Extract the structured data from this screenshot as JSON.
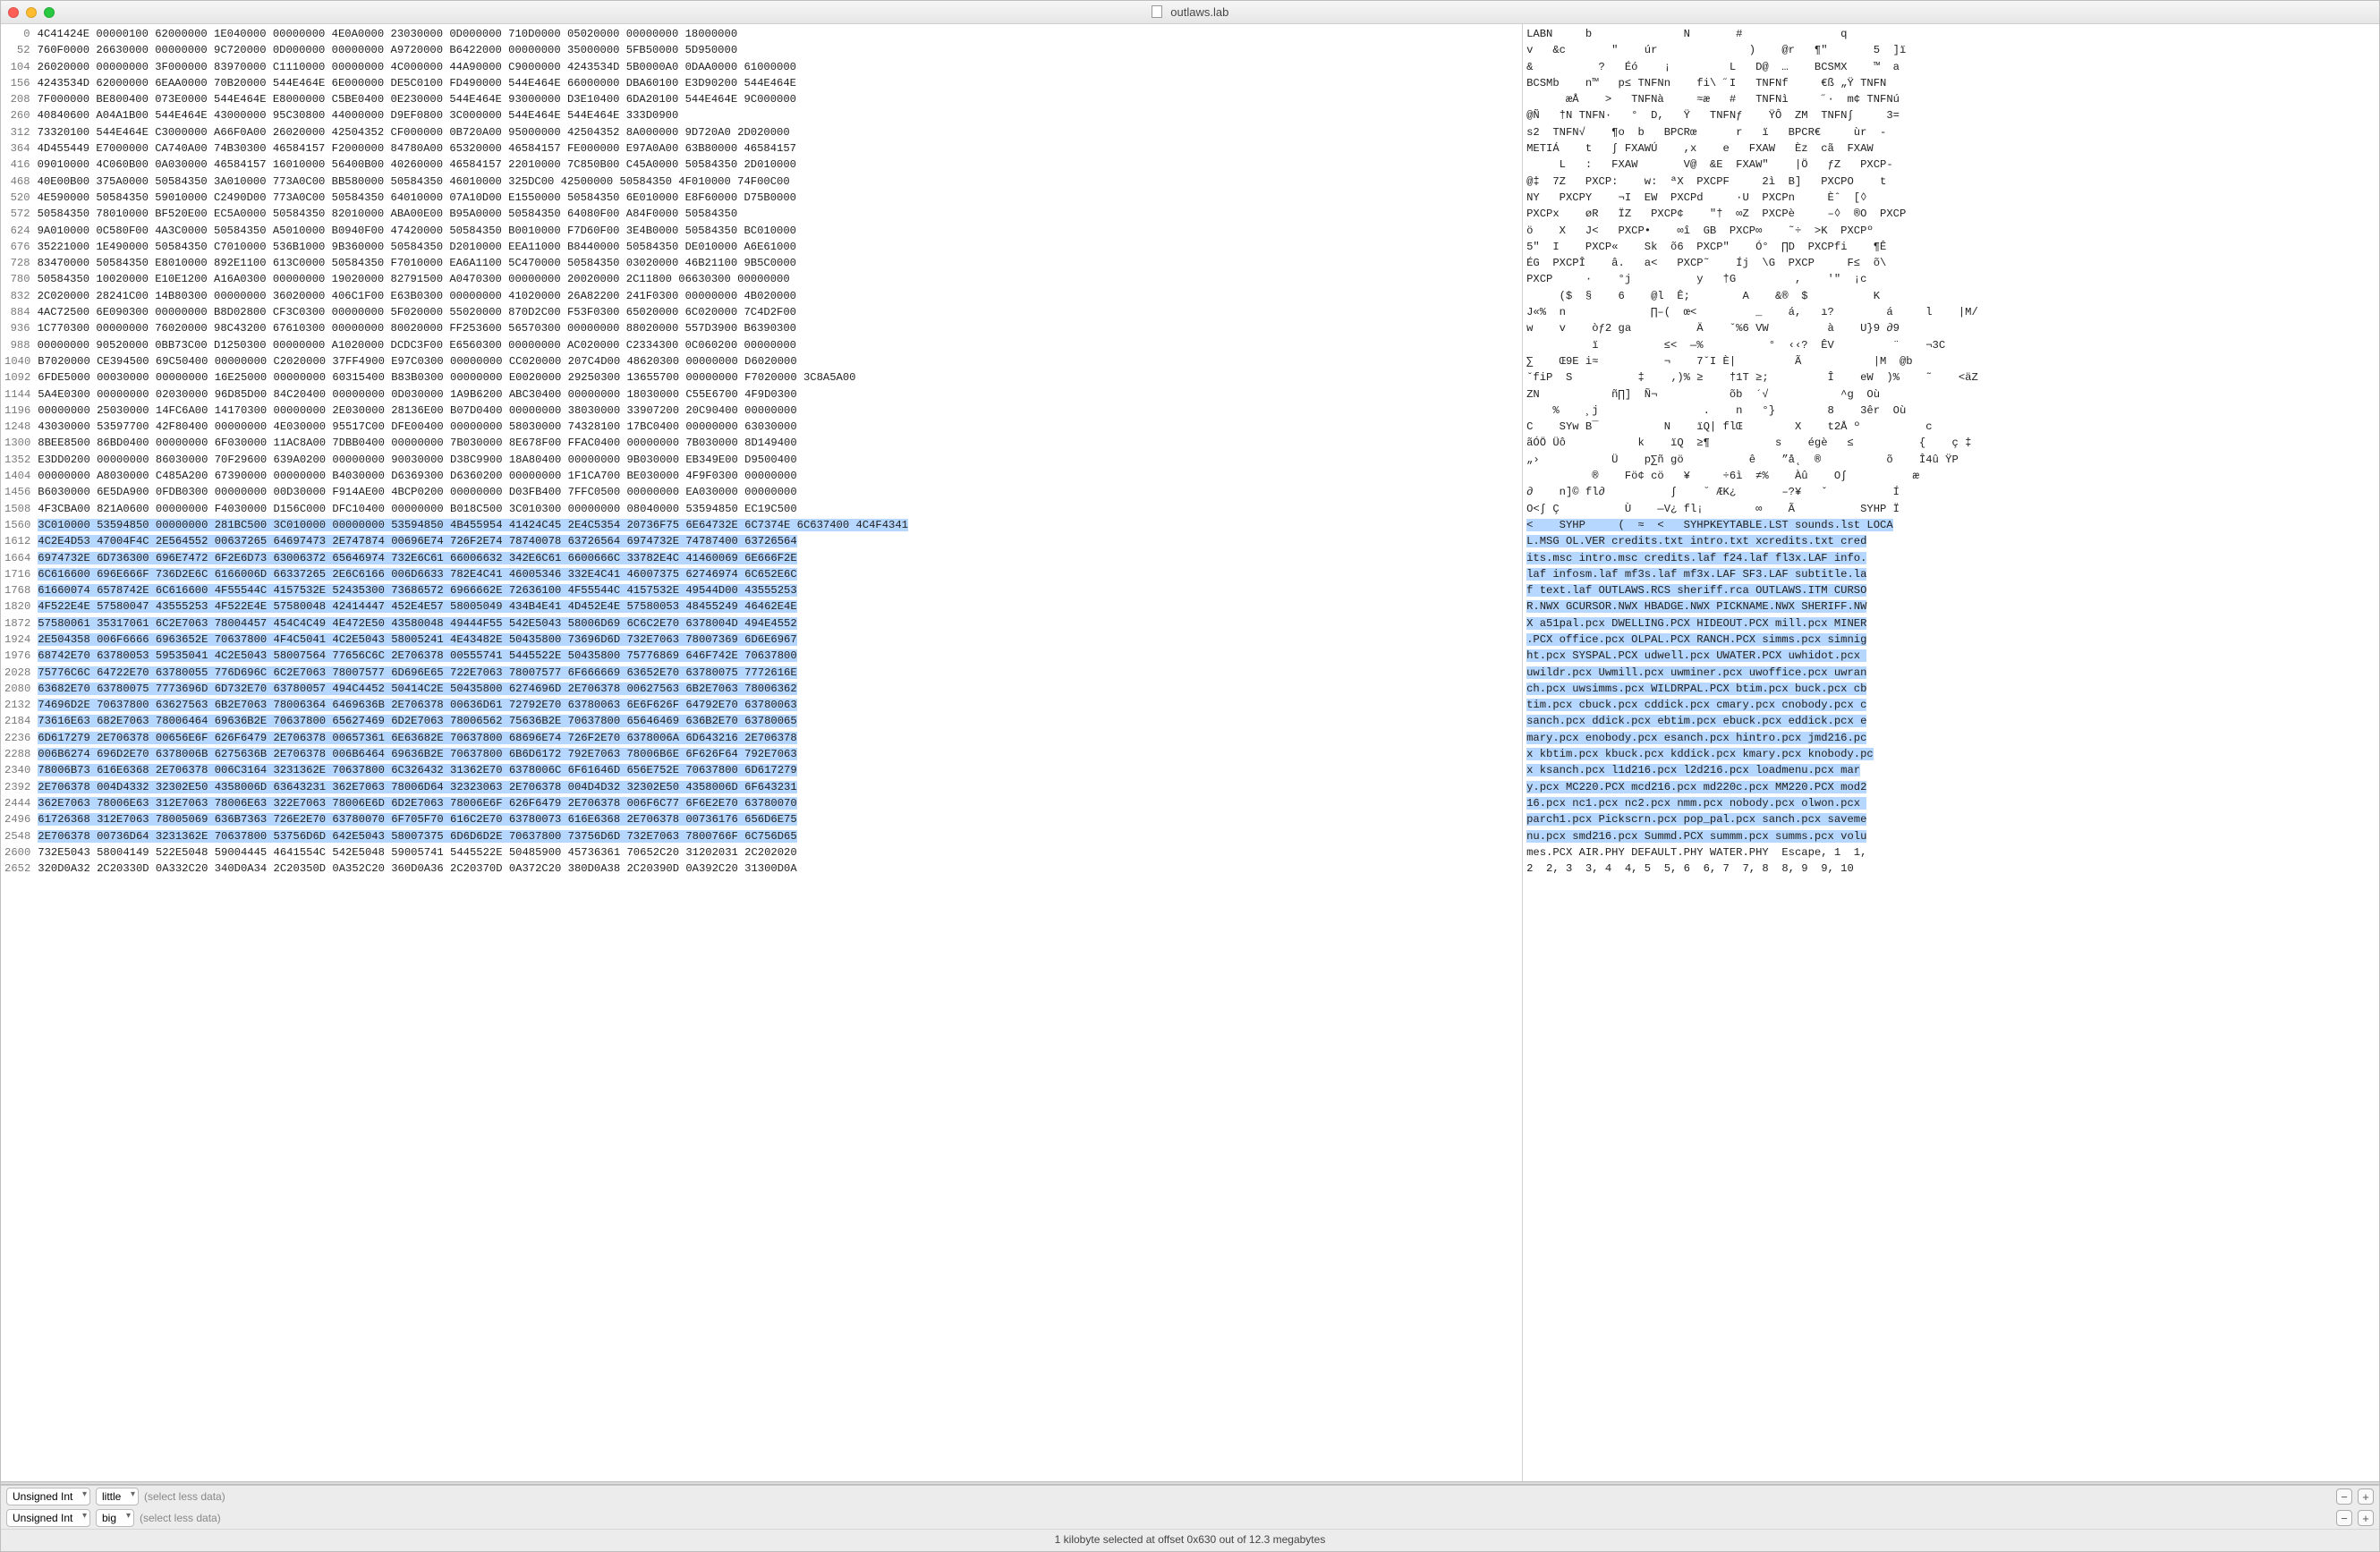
{
  "window": {
    "title": "outlaws.lab"
  },
  "hex": {
    "start_offset": 0,
    "bytes_per_row": 52,
    "selection": {
      "start": 1560,
      "end": 2599
    },
    "rows": [
      {
        "o": 0,
        "h": "4C41424E 00000100 62000000 1E040000 00000000 4E0A0000 23030000 0D000000 710D0000 05020000 00000000 18000000"
      },
      {
        "o": 52,
        "h": "760F0000 26630000 00000000 9C720000 0D000000 00000000 A9720000 B6422000 00000000 35000000 5FB50000 5D950000"
      },
      {
        "o": 104,
        "h": "26020000 00000000 3F000000 83970000 C1110000 00000000 4C000000 44A90000 C9000000 4243534D 5B0000A0 0DAA0000 61000000"
      },
      {
        "o": 156,
        "h": "4243534D 62000000 6EAA0000 70B20000 544E464E 6E000000 DE5C0100 FD490000 544E464E 66000000 DBA60100 E3D90200 544E464E"
      },
      {
        "o": 208,
        "h": "7F000000 BE800400 073E0000 544E464E E8000000 C5BE0400 0E230000 544E464E 93000000 D3E10400 6DA20100 544E464E 9C000000"
      },
      {
        "o": 260,
        "h": "40840600 A04A1B00 544E464E 43000000 95C30800 44000000 D9EF0800 3C000000 544E464E 544E464E 333D0900"
      },
      {
        "o": 312,
        "h": "73320100 544E464E C3000000 A66F0A00 26020000 42504352 CF000000 0B720A00 95000000 42504352 8A000000 9D720A0 2D020000"
      },
      {
        "o": 364,
        "h": "4D455449 E7000000 CA740A00 74B30300 46584157 F2000000 84780A00 65320000 46584157 FE000000 E97A0A00 63B80000 46584157"
      },
      {
        "o": 416,
        "h": "09010000 4C060B00 0A030000 46584157 16010000 56400B00 40260000 46584157 22010000 7C850B00 C45A0000 50584350 2D010000"
      },
      {
        "o": 468,
        "h": "40E00B00 375A0000 50584350 3A010000 773A0C00 BB580000 50584350 46010000 325DC00 42500000 50584350 4F010000 74F00C00"
      },
      {
        "o": 520,
        "h": "4E590000 50584350 59010000 C2490D00 773A0C00 50584350 64010000 07A10D00 E1550000 50584350 6E010000 E8F60000 D75B0000"
      },
      {
        "o": 572,
        "h": "50584350 78010000 BF520E00 EC5A0000 50584350 82010000 ABA00E00 B95A0000 50584350 64080F00 A84F0000 50584350"
      },
      {
        "o": 624,
        "h": "9A010000 0C580F00 4A3C0000 50584350 A5010000 B0940F00 47420000 50584350 B0010000 F7D60F00 3E4B0000 50584350 BC010000"
      },
      {
        "o": 676,
        "h": "35221000 1E490000 50584350 C7010000 536B1000 9B360000 50584350 D2010000 EEA11000 B8440000 50584350 DE010000 A6E61000"
      },
      {
        "o": 728,
        "h": "83470000 50584350 E8010000 892E1100 613C0000 50584350 F7010000 EA6A1100 5C470000 50584350 03020000 46B21100 9B5C0000"
      },
      {
        "o": 780,
        "h": "50584350 10020000 E10E1200 A16A0300 00000000 19020000 82791500 A0470300 00000000 20020000 2C11800 06630300 00000000"
      },
      {
        "o": 832,
        "h": "2C020000 28241C00 14B80300 00000000 36020000 406C1F00 E63B0300 00000000 41020000 26A82200 241F0300 00000000 4B020000"
      },
      {
        "o": 884,
        "h": "4AC72500 6E090300 00000000 B8D02800 CF3C0300 00000000 5F020000 55020000 870D2C00 F53F0300 65020000 6C020000 7C4D2F00"
      },
      {
        "o": 936,
        "h": "1C770300 00000000 76020000 98C43200 67610300 00000000 80020000 FF253600 56570300 00000000 88020000 557D3900 B6390300"
      },
      {
        "o": 988,
        "h": "00000000 90520000 0BB73C00 D1250300 00000000 A1020000 DCDC3F00 E6560300 00000000 AC020000 C2334300 0C060200 00000000"
      },
      {
        "o": 1040,
        "h": "B7020000 CE394500 69C50400 00000000 C2020000 37FF4900 E97C0300 00000000 CC020000 207C4D00 48620300 00000000 D6020000"
      },
      {
        "o": 1092,
        "h": "6FDE5000 00030000 00000000 16E25000 00000000 60315400 B83B0300 00000000 E0020000 29250300 13655700 00000000 F7020000 3C8A5A00"
      },
      {
        "o": 1144,
        "h": "5A4E0300 00000000 02030000 96D85D00 84C20400 00000000 0D030000 1A9B6200 ABC30400 00000000 18030000 C55E6700 4F9D0300"
      },
      {
        "o": 1196,
        "h": "00000000 25030000 14FC6A00 14170300 00000000 2E030000 28136E00 B07D0400 00000000 38030000 33907200 20C90400 00000000"
      },
      {
        "o": 1248,
        "h": "43030000 53597700 42F80400 00000000 4E030000 95517C00 DFE00400 00000000 58030000 74328100 17BC0400 00000000 63030000"
      },
      {
        "o": 1300,
        "h": "8BEE8500 86BD0400 00000000 6F030000 11AC8A00 7DBB0400 00000000 7B030000 8E678F00 FFAC0400 00000000 7B030000 8D149400"
      },
      {
        "o": 1352,
        "h": "E3DD0200 00000000 86030000 70F29600 639A0200 00000000 90030000 D38C9900 18A80400 00000000 9B030000 EB349E00 D9500400"
      },
      {
        "o": 1404,
        "h": "00000000 A8030000 C485A200 67390000 00000000 B4030000 D6369300 D6360200 00000000 1F1CA700 BE030000 4F9F0300 00000000"
      },
      {
        "o": 1456,
        "h": "B6030000 6E5DA900 0FDB0300 00000000 00D30000 F914AE00 4BCP0200 00000000 D03FB400 7FFC0500 00000000 EA030000 00000000"
      },
      {
        "o": 1508,
        "h": "4F3CBA00 821A0600 00000000 F4030000 D156C000 DFC10400 00000000 B018C500 3C010300 00000000 08040000 53594850 EC19C500"
      },
      {
        "o": 1560,
        "h": "3C010000 53594850 00000000 281BC500 3C010000 00000000 53594850 4B455954 41424C45 2E4C5354 20736F75 6E64732E 6C7374E 6C637400 4C4F4341"
      },
      {
        "o": 1612,
        "h": "4C2E4D53 47004F4C 2E564552 00637265 64697473 2E747874 00696E74 726F2E74 78740078 63726564 6974732E 74787400 63726564"
      },
      {
        "o": 1664,
        "h": "6974732E 6D736300 696E7472 6F2E6D73 63006372 65646974 732E6C61 66006632 342E6C61 6600666C 33782E4C 41460069 6E666F2E"
      },
      {
        "o": 1716,
        "h": "6C616600 696E666F 736D2E6C 6166006D 66337265 2E6C6166 006D6633 782E4C41 46005346 332E4C41 46007375 62746974 6C652E6C"
      },
      {
        "o": 1768,
        "h": "61660074 6578742E 6C616600 4F55544C 4157532E 52435300 73686572 6966662E 72636100 4F55544C 4157532E 49544D00 43555253"
      },
      {
        "o": 1820,
        "h": "4F522E4E 57580047 43555253 4F522E4E 57580048 42414447 452E4E57 58005049 434B4E41 4D452E4E 57580053 48455249 46462E4E"
      },
      {
        "o": 1872,
        "h": "57580061 35317061 6C2E7063 78004457 454C4C49 4E472E50 43580048 49444F55 542E5043 58006D69 6C6C2E70 6378004D 494E4552"
      },
      {
        "o": 1924,
        "h": "2E504358 006F6666 6963652E 70637800 4F4C5041 4C2E5043 58005241 4E43482E 50435800 73696D6D 732E7063 78007369 6D6E6967"
      },
      {
        "o": 1976,
        "h": "68742E70 63780053 59535041 4C2E5043 58007564 77656C6C 2E706378 00555741 5445522E 50435800 75776869 646F742E 70637800"
      },
      {
        "o": 2028,
        "h": "75776C6C 64722E70 63780055 776D696C 6C2E7063 78007577 6D696E65 722E7063 78007577 6F666669 63652E70 63780075 7772616E"
      },
      {
        "o": 2080,
        "h": "63682E70 63780075 7773696D 6D732E70 63780057 494C4452 50414C2E 50435800 6274696D 2E706378 00627563 6B2E7063 78006362"
      },
      {
        "o": 2132,
        "h": "74696D2E 70637800 63627563 6B2E7063 78006364 6469636B 2E706378 00636D61 72792E70 63780063 6E6F626F 64792E70 63780063"
      },
      {
        "o": 2184,
        "h": "73616E63 682E7063 78006464 69636B2E 70637800 65627469 6D2E7063 78006562 75636B2E 70637800 65646469 636B2E70 63780065"
      },
      {
        "o": 2236,
        "h": "6D617279 2E706378 00656E6F 626F6479 2E706378 00657361 6E63682E 70637800 68696E74 726F2E70 6378006A 6D643216 2E706378"
      },
      {
        "o": 2288,
        "h": "006B6274 696D2E70 6378006B 6275636B 2E706378 006B6464 69636B2E 70637800 6B6D6172 792E7063 78006B6E 6F626F64 792E7063"
      },
      {
        "o": 2340,
        "h": "78006B73 616E6368 2E706378 006C3164 3231362E 70637800 6C326432 31362E70 6378006C 6F61646D 656E752E 70637800 6D617279"
      },
      {
        "o": 2392,
        "h": "2E706378 004D4332 32302E50 4358006D 63643231 362E7063 78006D64 32323063 2E706378 004D4D32 32302E50 4358006D 6F643231"
      },
      {
        "o": 2444,
        "h": "362E7063 78006E63 312E7063 78006E63 322E7063 78006E6D 6D2E7063 78006E6F 626F6479 2E706378 006F6C77 6F6E2E70 63780070"
      },
      {
        "o": 2496,
        "h": "61726368 312E7063 78005069 636B7363 726E2E70 63780070 6F705F70 616C2E70 63780073 616E6368 2E706378 00736176 656D6E75"
      },
      {
        "o": 2548,
        "h": "2E706378 00736D64 3231362E 70637800 53756D6D 642E5043 58007375 6D6D6D2E 70637800 73756D6D 732E7063 7800766F 6C756D65"
      },
      {
        "o": 2600,
        "h": "732E5043 58004149 522E5048 59004445 4641554C 542E5048 59005741 5445522E 50485900 45736361 70652C20 31202031 2C202020"
      },
      {
        "o": 2652,
        "h": "320D0A32 2C20330D 0A332C20 340D0A34 2C20350D 0A352C20 360D0A36 2C20370D 0A372C20 380D0A38 2C20390D 0A392C20 31300D0A"
      }
    ]
  },
  "ascii": {
    "rows": [
      "LABN     b              N       #               q",
      "v   &c       \"    úr              )    @r   ¶\"       5  ]ï",
      "&          ?   Éó    ¡         L   D@  …    BCSMX    ™  a",
      "BCSMb    n™   p≤ TNFNn    fi\\ ˝I   TNFNf     €ß „Ÿ TNFN",
      "      æÅ    >   TNFNà     ≈æ   #   TNFNì     ˝·  m¢ TNFNú",
      "@Ñ   †N TNFN·   °  D,   Ÿ   TNFNƒ    ŸÔ  ZM  TNFN∫     3=",
      "s2  TNFN√    ¶o  b   BPCRœ      r   ï   BPCR€     ùr  -",
      "METIÁ    t   ∫ FXAWÚ    ,x    e   FXAW   Èz  cã  FXAW",
      "     L   :   FXAW       V@  &E  FXAW\"    |Ö   ƒZ   PXCP-",
      "@‡  7Z   PXCP:    w:  ªX  PXCPF     2ì  B]   PXCPO    t",
      "NY   PXCPY    ¬I  EW  PXCPd     ·U  PXCPn     Èˆ  [◊",
      "PXCPx    øR   ÏZ   PXCP¢    \"†  ∞Z  PXCPè     –◊  ®O  PXCP",
      "ö    X   J<   PXCP•    ∞î  GB  PXCP∞    ˜÷  >K  PXCPº",
      "5\"  I    PXCP«    Sk  õ6  PXCP\"    Ó°  ∏D  PXCPfi    ¶Ê",
      "ÉG  PXCPÎ    â.   a<   PXCP˜    Íj  \\G  PXCP     F≤  õ\\",
      "PXCP     ·    °j          y   †G         ,    '\"  ¡c",
      "     ($  §    6    @l  Ê;        A    &®  $          K",
      "J«%  n             ∏–(  œ<         _    á,   ı?        á     l    |M/",
      "w    v    òƒ2 ga          Ä    ˇ%6 VW         à    U}9 ∂9",
      "          ï          ≤<  —%          °  ‹‹?  ÊV         ¨    ¬3C",
      "∑    Œ9E i≈          ¬    7ˇI È|         Ã           |M  @b",
      "ˇfiP  S          ‡    ‚)% ≥    †1T ≥;         Î    eW  )%    ˜    <äZ",
      "ZN           ñ∏]  Ñ¬           õb  ´√           ^g  Où",
      "    %    ¸j                .    n   °}        8    3êr  Où",
      "C    SYw B¯          N    ïQ| flŒ        X    t2Å º          c",
      "ãÓÖ Üô           k    ïQ  ≥¶          s    égè   ≤          {    ç ‡",
      "„›           Ü    p∑ñ gö          ê    ”å˛  ®          õ    Î4û ŸP",
      "          ®    Fö¢ cö   ¥     ÷6ì  ≠%    Àû    O∫          æ",
      "∂    n]© fl∂          ∫    ˘ ÆK¿       –?¥   ˇ          Í",
      "O<∫ Ç          Ù    —V¿ fl¡        ∞    Ã          SYHP Ï",
      "<    SYHP     (  ≈  <   SYHPKEYTABLE.LST sounds.lst LOCA",
      "L.MSG OL.VER credits.txt intro.txt xcredits.txt cred",
      "its.msc intro.msc credits.laf f24.laf fl3x.LAF info.",
      "laf infosm.laf mf3s.laf mf3x.LAF SF3.LAF subtitle.la",
      "f text.laf OUTLAWS.RCS sheriff.rca OUTLAWS.ITM CURSO",
      "R.NWX GCURSOR.NWX HBADGE.NWX PICKNAME.NWX SHERIFF.NW",
      "X a51pal.pcx DWELLING.PCX HIDEOUT.PCX mill.pcx MINER",
      ".PCX office.pcx OLPAL.PCX RANCH.PCX simms.pcx simnig",
      "ht.pcx SYSPAL.PCX udwell.pcx UWATER.PCX uwhidot.pcx ",
      "uwildr.pcx Uwmill.pcx uwminer.pcx uwoffice.pcx uwran",
      "ch.pcx uwsimms.pcx WILDRPAL.PCX btim.pcx buck.pcx cb",
      "tim.pcx cbuck.pcx cddick.pcx cmary.pcx cnobody.pcx c",
      "sanch.pcx ddick.pcx ebtim.pcx ebuck.pcx eddick.pcx e",
      "mary.pcx enobody.pcx esanch.pcx hintro.pcx jmd216.pc",
      "x kbtim.pcx kbuck.pcx kddick.pcx kmary.pcx knobody.pc",
      "x ksanch.pcx l1d216.pcx l2d216.pcx loadmenu.pcx mar",
      "y.pcx MC220.PCX mcd216.pcx md220c.pcx MM220.PCX mod2",
      "16.pcx nc1.pcx nc2.pcx nmm.pcx nobody.pcx olwon.pcx ",
      "parch1.pcx Pickscrn.pcx pop_pal.pcx sanch.pcx saveme",
      "nu.pcx smd216.pcx Summd.PCX summm.pcx summs.pcx volu",
      "mes.PCX AIR.PHY DEFAULT.PHY WATER.PHY  Escape, 1  1,",
      "2  2, 3  3, 4  4, 5  5, 6  6, 7  7, 8  8, 9  9, 10"
    ]
  },
  "footer": {
    "type_label": "Unsigned Int",
    "endian_a": "little",
    "endian_b": "big",
    "hint": "(select less data)"
  },
  "status": "1 kilobyte selected at offset 0x630 out of 12.3 megabytes"
}
